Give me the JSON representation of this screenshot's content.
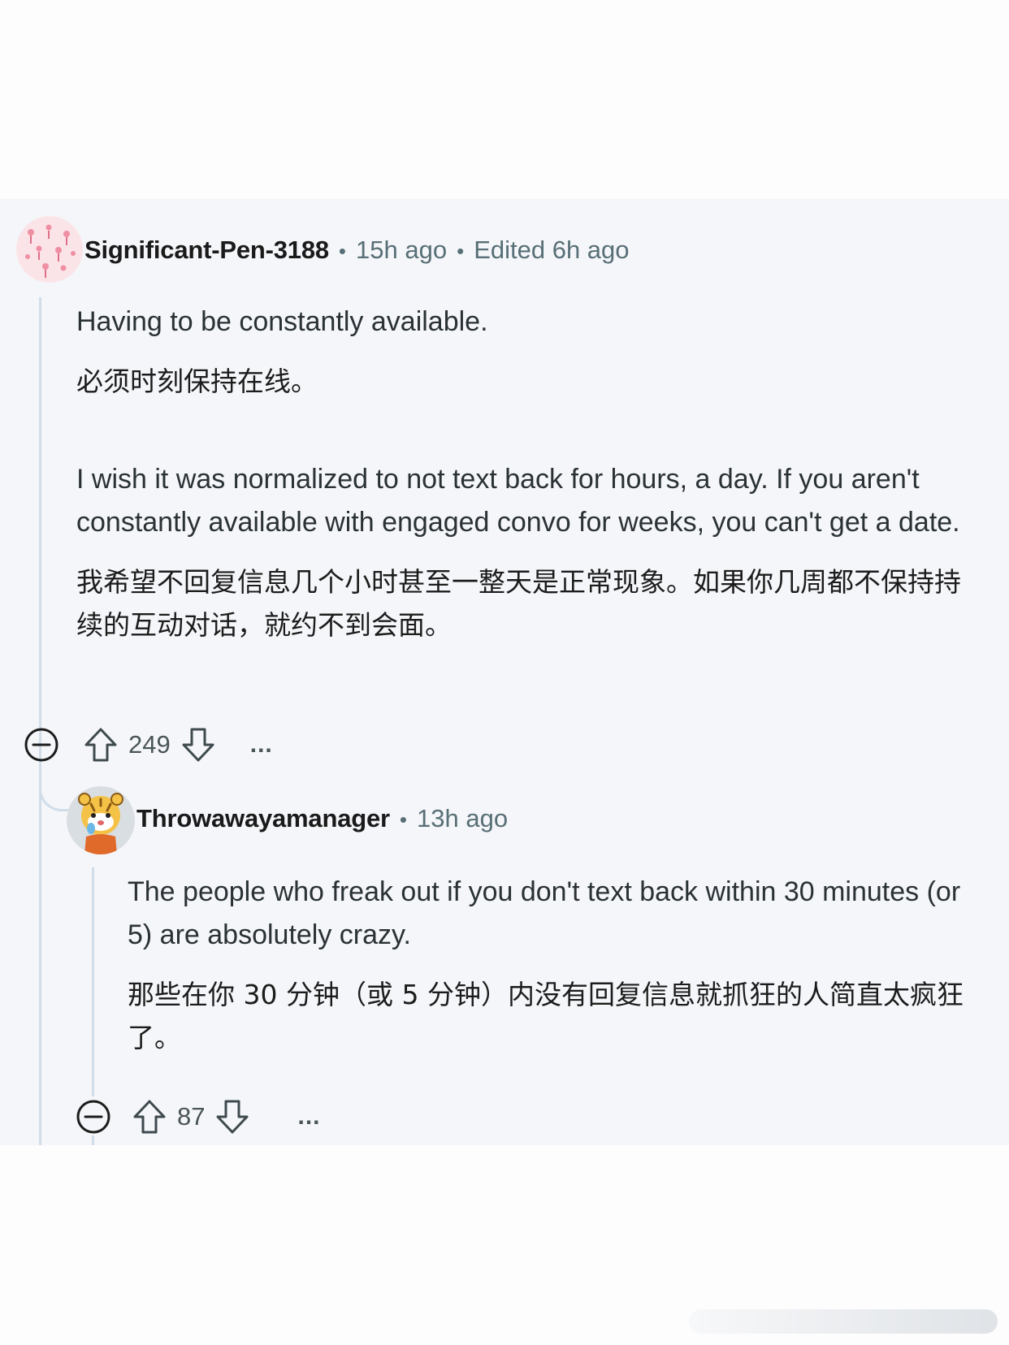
{
  "comments": [
    {
      "username": "Significant-Pen-3188",
      "time": "15h ago",
      "edited": "Edited 6h ago",
      "avatar_icon": "flamingo-pattern-avatar",
      "paragraphs": [
        "Having to be constantly available.",
        "必须时刻保持在线。",
        "I wish it was normalized to not text back for hours, a day. If you aren't constantly available with engaged convo for weeks, you can't get a date.",
        "我希望不回复信息几个小时甚至一整天是正常现象。如果你几周都不保持持续的互动对话，就约不到会面。"
      ],
      "votes": "249",
      "more": "..."
    },
    {
      "username": "Throwawayamanager",
      "time": "13h ago",
      "avatar_icon": "cartoon-tiger-avatar",
      "paragraphs": [
        "The people who freak out if you don't text back within 30 minutes (or 5) are absolutely crazy.",
        "那些在你 30 分钟（或 5 分钟）内没有回复信息就抓狂的人简直太疯狂了。"
      ],
      "votes": "87",
      "more": "..."
    }
  ],
  "colors": {
    "thread_background": "#f5f6f9",
    "rail": "#d0dde8",
    "meta_text": "#576f76"
  }
}
